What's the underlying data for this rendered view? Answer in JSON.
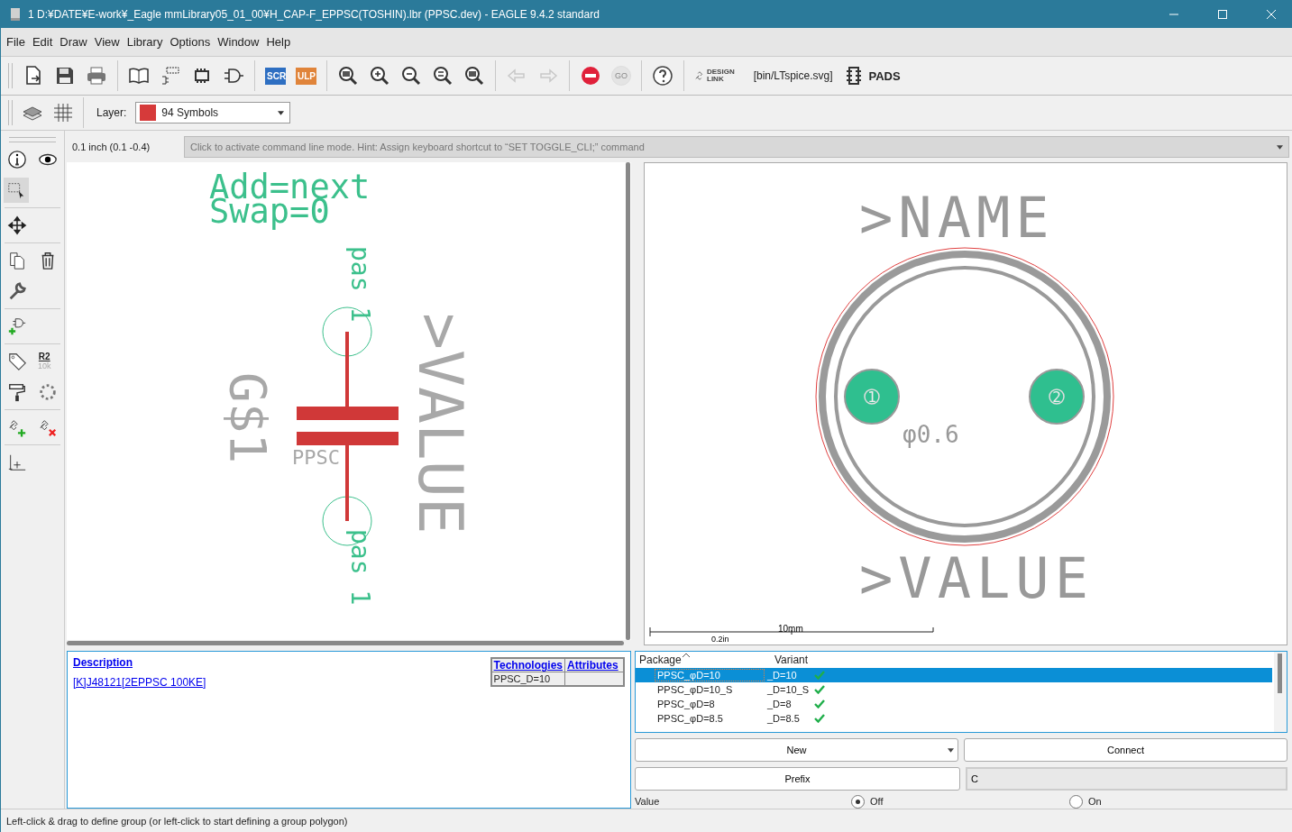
{
  "window": {
    "title": "1 D:¥DATE¥E-work¥_Eagle mmLibrary05_01_00¥H_CAP-F_EPPSC(TOSHIN).lbr (PPSC.dev) - EAGLE 9.4.2 standard"
  },
  "menu": [
    "File",
    "Edit",
    "Draw",
    "View",
    "Library",
    "Options",
    "Window",
    "Help"
  ],
  "toolbar": {
    "scr": "SCR",
    "ulp": "ULP",
    "undo": {
      "disabled": true
    },
    "redo": {
      "disabled": true
    },
    "go": {
      "label": "GO",
      "disabled": true
    },
    "design_link": [
      "DESIGN",
      "LINK"
    ],
    "script": "[bin/LTspice.svg]",
    "pads": "PADS"
  },
  "layer": {
    "label": "Layer:",
    "value": "94 Symbols",
    "color": "#d63a3a"
  },
  "command": {
    "coordinates": "0.1 inch (0.1 -0.4)",
    "placeholder": "Click to activate command line mode. Hint: Assign keyboard shortcut to “SET TOGGLE_CLI;” command"
  },
  "tools": {
    "group_selected": true,
    "name_label": "R2",
    "value_label": "10k"
  },
  "symbol": {
    "add": "Add=next",
    "swap": "Swap=0",
    "pin_top": "pas 1",
    "pin_bottom": "pas 1",
    "value": ">VALUE",
    "name": "G$1",
    "symbol_name": "PPSC"
  },
  "package_preview": {
    "name": ">NAME",
    "value": ">VALUE",
    "drill": "φ0.6",
    "pads": [
      "1",
      "2"
    ],
    "scale_metric": "10mm",
    "scale_imperial": "0.2in"
  },
  "description": {
    "heading": "Description",
    "link": "[K]J48121[2EPPSC 100KE]",
    "table": {
      "columns": [
        "Technologies",
        "Attributes"
      ],
      "rows": [
        {
          "technology": "PPSC_D=10"
        }
      ]
    }
  },
  "packages": {
    "columns": [
      "Package",
      "Variant"
    ],
    "rows": [
      {
        "package": "PPSC_φD=10",
        "variant": "_D=10",
        "ok": true,
        "selected": true
      },
      {
        "package": "PPSC_φD=10_S",
        "variant": "_D=10_S",
        "ok": true,
        "selected": false
      },
      {
        "package": "PPSC_φD=8",
        "variant": "_D=8",
        "ok": true,
        "selected": false
      },
      {
        "package": "PPSC_φD=8.5",
        "variant": "_D=8.5",
        "ok": true,
        "selected": false
      }
    ]
  },
  "buttons": {
    "new": "New",
    "connect": "Connect",
    "prefix": "Prefix"
  },
  "prefix_value": "C",
  "value_option": {
    "label": "Value",
    "options": [
      {
        "label": "Off",
        "selected": true
      },
      {
        "label": "On",
        "selected": false
      }
    ]
  },
  "status_bar": "Left-click & drag to define group (or left-click to start defining a group polygon)"
}
